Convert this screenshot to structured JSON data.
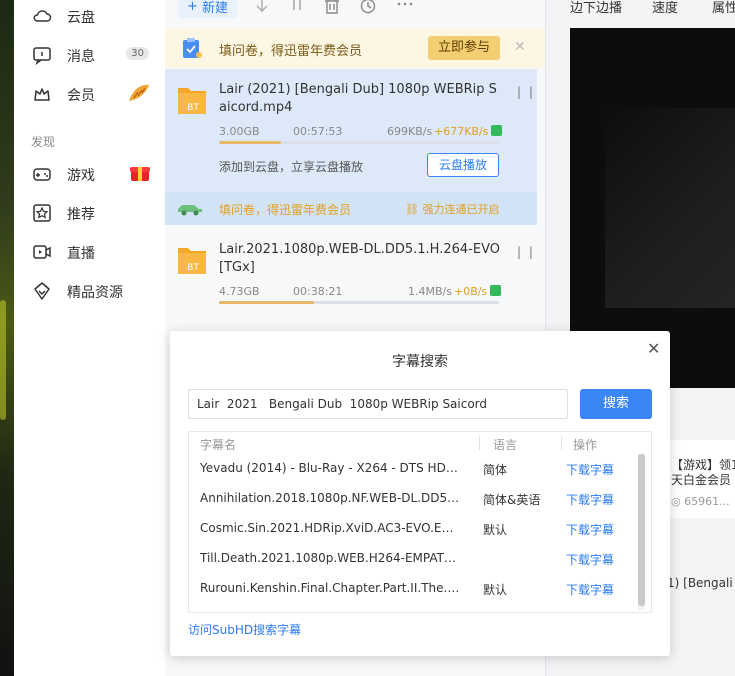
{
  "sidebar": {
    "items": [
      {
        "label": "云盘",
        "icon": "cloud-icon"
      },
      {
        "label": "消息",
        "icon": "message-icon",
        "badge": "30"
      },
      {
        "label": "会员",
        "icon": "crown-icon",
        "extra_icon": "croissant-icon"
      },
      {
        "label": "游戏",
        "icon": "gamepad-icon",
        "extra_icon": "gift-box-icon"
      },
      {
        "label": "推荐",
        "icon": "star-icon"
      },
      {
        "label": "直播",
        "icon": "live-video-icon"
      },
      {
        "label": "精品资源",
        "icon": "gem-icon"
      }
    ],
    "section_title": "发现"
  },
  "toolbar": {
    "new_label": "新建",
    "icons": [
      "download-icon",
      "pause-icon",
      "delete-icon",
      "clock-icon",
      "more-icon"
    ]
  },
  "promo": {
    "text": "填问卷，得迅雷年费会员",
    "button": "立即参与",
    "close": "✕"
  },
  "tasks": [
    {
      "name": "Lair (2021) [Bengali Dub] 1080p WEBRip Saicord.mp4",
      "file_badge": "BT",
      "size": "3.00GB",
      "remaining": "00:57:53",
      "speed": "699KB/s",
      "boost": "+677KB/s",
      "progress": 0.22,
      "cloud_text": "添加到云盘，立享云盘播放",
      "cloud_button": "云盘播放",
      "promo_text": "填问卷，得迅雷年费会员",
      "promo_right": "强力连通已开启"
    },
    {
      "name": "Lair.2021.1080p.WEB-DL.DD5.1.H.264-EVO[TGx]",
      "file_badge": "BT",
      "size": "4.73GB",
      "remaining": "00:38:21",
      "speed": "1.4MB/s",
      "boost": "+0B/s",
      "progress": 0.34
    }
  ],
  "right_panel": {
    "tabs": [
      "边下边播",
      "速度",
      "属性"
    ],
    "ad_line1": "【游戏】领1",
    "ad_line2": "天白金会员",
    "ad_meta": "65961...",
    "bottom_text": "1) [Bengali"
  },
  "dialog": {
    "title": "字幕搜索",
    "search_value": "Lair  2021   Bengali Dub  1080p WEBRip Saicord",
    "search_button": "搜索",
    "columns": [
      "字幕名",
      "语言",
      "操作"
    ],
    "rows": [
      {
        "name": "Yevadu (2014) - Blu-Ray - X264 - DTS HDMA...",
        "lang": "简体",
        "op": "下载字幕"
      },
      {
        "name": "Annihilation.2018.1080p.NF.WEB-DL.DD5.1...",
        "lang": "简体&英语",
        "op": "下载字幕"
      },
      {
        "name": "Cosmic.Sin.2021.HDRip.XviD.AC3-EVO.EN&...",
        "lang": "默认",
        "op": "下载字幕"
      },
      {
        "name": "Till.Death.2021.1080p.WEB.H264-EMPATHY....",
        "lang": "",
        "op": "下载字幕"
      },
      {
        "name": "Rurouni.Kenshin.Final.Chapter.Part.II.The.Be...",
        "lang": "默认",
        "op": "下载字幕"
      }
    ],
    "footer_link": "访问SubHD搜索字幕",
    "close": "✕"
  },
  "colors": {
    "accent": "#3a86f6",
    "promo_bg": "#fdf6e3",
    "selected_task_bg": "#dde9f9",
    "boost": "#e0a020",
    "link": "#2b7cf6"
  }
}
